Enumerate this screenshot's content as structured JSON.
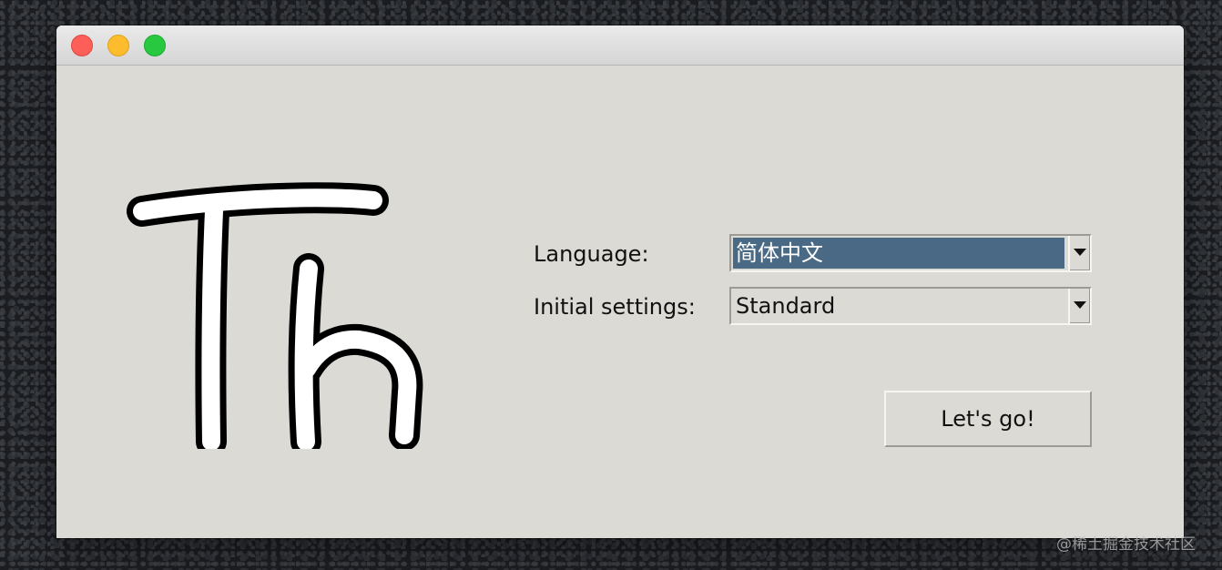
{
  "window": {
    "controls": {
      "close_icon": "close-traffic-light",
      "minimize_icon": "minimize-traffic-light",
      "zoom_icon": "zoom-traffic-light"
    }
  },
  "logo": {
    "icon": "th-handwritten-logo",
    "text": "Th"
  },
  "form": {
    "language_label": "Language:",
    "language_value": "简体中文",
    "initial_settings_label": "Initial settings:",
    "initial_settings_value": "Standard",
    "dropdown_icon": "triangle-down-icon"
  },
  "actions": {
    "go_label": "Let's go!"
  },
  "watermark": {
    "text": "@稀土掘金技术社区"
  },
  "colors": {
    "window_bg": "#dbdad5",
    "selection_bg": "#4a6984",
    "close": "#fc5f57",
    "minimize": "#fdbc2e",
    "zoom": "#28c840"
  }
}
